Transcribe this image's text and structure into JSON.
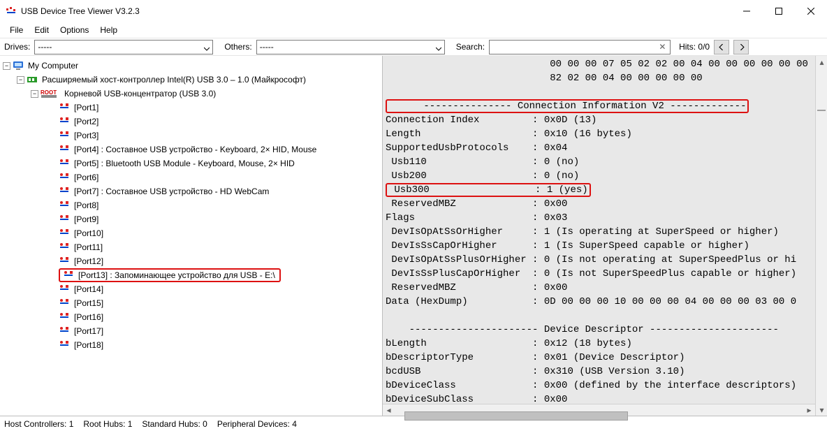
{
  "window": {
    "title": "USB Device Tree Viewer V3.2.3"
  },
  "menu": {
    "file": "File",
    "edit": "Edit",
    "options": "Options",
    "help": "Help"
  },
  "toolbar": {
    "drives_label": "Drives:",
    "drives_value": "-----",
    "others_label": "Others:",
    "others_value": "-----",
    "search_label": "Search:",
    "search_value": "",
    "hits_label": "Hits:",
    "hits_value": "0/0",
    "prev": "<",
    "next": ">"
  },
  "tree": {
    "root": "My Computer",
    "host": "Расширяемый хост-контроллер Intel(R) USB 3.0 – 1.0 (Майкрософт)",
    "hub": "Корневой USB-концентратор (USB 3.0)",
    "ports": [
      "[Port1]",
      "[Port2]",
      "[Port3]",
      "[Port4] : Составное USB устройство - Keyboard, 2× HID, Mouse",
      "[Port5] : Bluetooth USB Module - Keyboard, Mouse, 2× HID",
      "[Port6]",
      "[Port7] : Составное USB устройство - HD WebCam",
      "[Port8]",
      "[Port9]",
      "[Port10]",
      "[Port11]",
      "[Port12]",
      "[Port13] : Запоминающее устройство для USB - E:\\",
      "[Port14]",
      "[Port15]",
      "[Port16]",
      "[Port17]",
      "[Port18]"
    ]
  },
  "details": {
    "hex_pre": "                            00 00 00 07 05 02 02 00 04 00 00 00 00 00 00\n                            82 02 00 04 00 00 00 00 00",
    "header_conninfo": "      --------------- Connection Information V2 -------------",
    "conninfo_block": "Connection Index         : 0x0D (13)\nLength                   : 0x10 (16 bytes)\nSupportedUsbProtocols    : 0x04\n Usb110                  : 0 (no)\n Usb200                  : 0 (no)",
    "usb300_line": " Usb300                  : 1 (yes)",
    "conninfo_after": " ReservedMBZ             : 0x00\nFlags                    : 0x03\n DevIsOpAtSsOrHigher     : 1 (Is operating at SuperSpeed or higher)\n DevIsSsCapOrHigher      : 1 (Is SuperSpeed capable or higher)\n DevIsOpAtSsPlusOrHigher : 0 (Is not operating at SuperSpeedPlus or hi\n DevIsSsPlusCapOrHigher  : 0 (Is not SuperSpeedPlus capable or higher)\n ReservedMBZ             : 0x00\nData (HexDump)           : 0D 00 00 00 10 00 00 00 04 00 00 00 03 00 0",
    "header_devdesc": "    ---------------------- Device Descriptor ----------------------",
    "devdesc_block": "bLength                  : 0x12 (18 bytes)\nbDescriptorType          : 0x01 (Device Descriptor)\nbcdUSB                   : 0x310 (USB Version 3.10)\nbDeviceClass             : 0x00 (defined by the interface descriptors)\nbDeviceSubClass          : 0x00"
  },
  "status": {
    "hostctrl": "Host Controllers: 1",
    "roothubs": "Root Hubs: 1",
    "stdhubs": "Standard Hubs: 0",
    "peripherals": "Peripheral Devices: 4"
  }
}
